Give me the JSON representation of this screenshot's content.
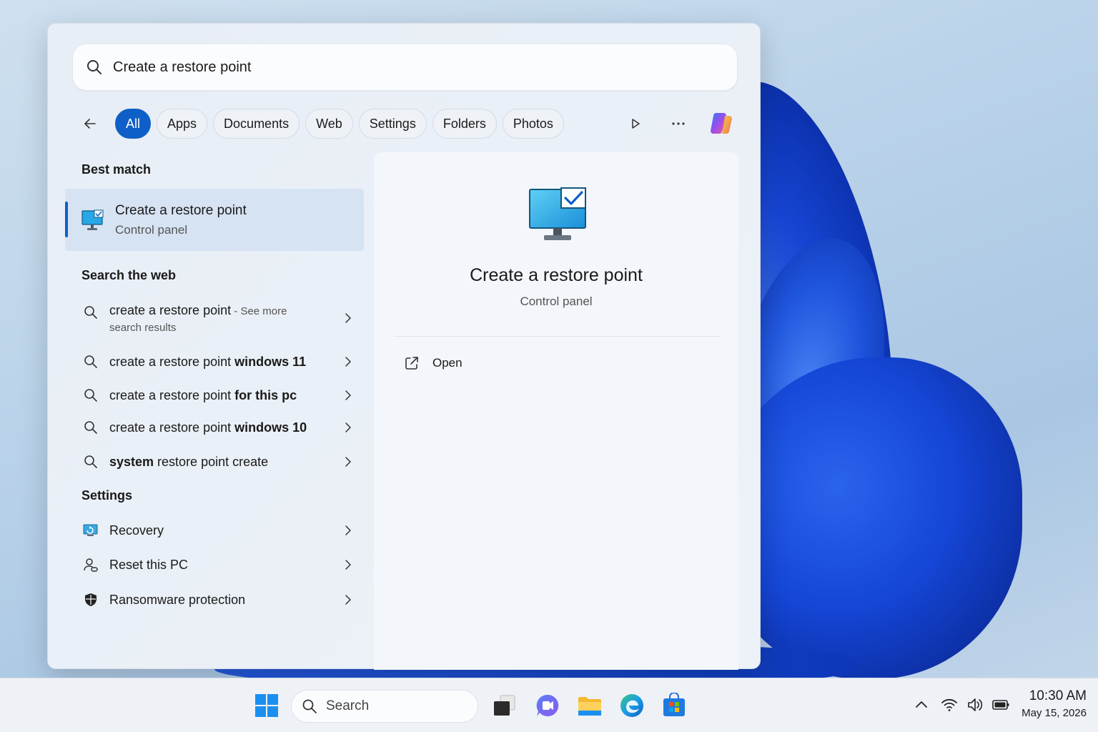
{
  "search": {
    "query": "Create a restore point"
  },
  "filters": {
    "chips": [
      "All",
      "Apps",
      "Documents",
      "Web",
      "Settings",
      "Folders",
      "Photos"
    ],
    "active": "All"
  },
  "best_match": {
    "heading": "Best match",
    "title": "Create a restore point",
    "subtitle": "Control panel"
  },
  "web": {
    "heading": "Search the web",
    "items": [
      {
        "normal": "create a restore point",
        "bold": "",
        "suffix": " - See more",
        "second_line": "search results"
      },
      {
        "normal": "create a restore point ",
        "bold": "windows 11"
      },
      {
        "normal": "create a restore point ",
        "bold": "for this pc"
      },
      {
        "normal": "create a restore point ",
        "bold": "windows 10"
      },
      {
        "normal": "",
        "bold": "system",
        "after": " restore point create"
      }
    ]
  },
  "settings": {
    "heading": "Settings",
    "items": [
      {
        "label": "Recovery",
        "icon": "recovery-icon"
      },
      {
        "label": "Reset this PC",
        "icon": "reset-icon"
      },
      {
        "label": "Ransomware protection",
        "icon": "shield-icon"
      }
    ]
  },
  "preview": {
    "title": "Create a restore point",
    "subtitle": "Control panel",
    "action": "Open"
  },
  "taskbar": {
    "search_label": "Search",
    "time": "10:30 AM",
    "date": "May 15, 2026"
  },
  "colors": {
    "accent": "#0f5fc8",
    "panel": "#edf2f8",
    "wallpaper_bloom": "#1746d4"
  }
}
